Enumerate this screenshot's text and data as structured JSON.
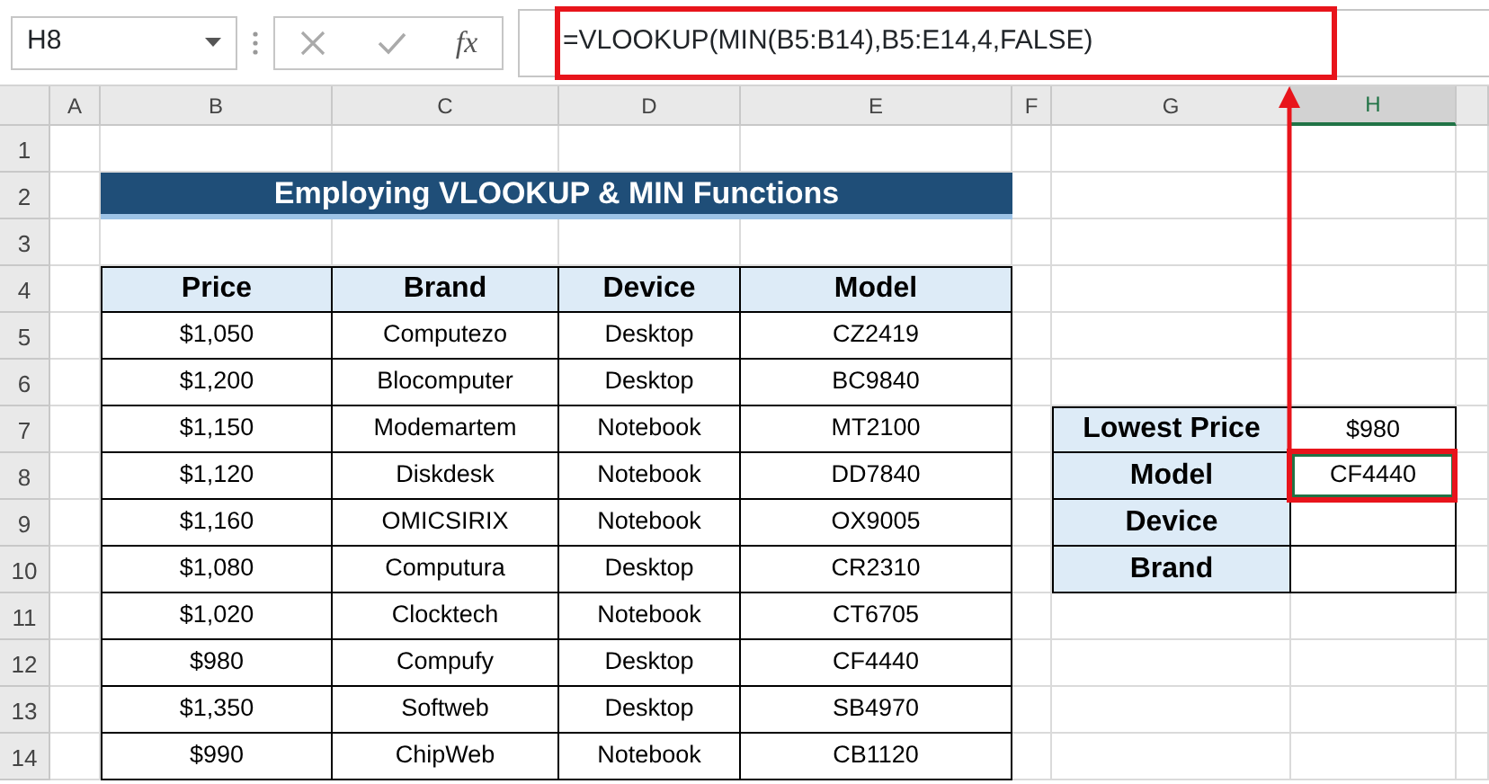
{
  "name_box": {
    "value": "H8"
  },
  "formula_bar": {
    "fx_label": "fx",
    "formula": "=VLOOKUP(MIN(B5:B14),B5:E14,4,FALSE)"
  },
  "columns": [
    {
      "label": "A",
      "selected": false
    },
    {
      "label": "B",
      "selected": false
    },
    {
      "label": "C",
      "selected": false
    },
    {
      "label": "D",
      "selected": false
    },
    {
      "label": "E",
      "selected": false
    },
    {
      "label": "F",
      "selected": false
    },
    {
      "label": "G",
      "selected": false
    },
    {
      "label": "H",
      "selected": true
    }
  ],
  "rows": [
    "1",
    "2",
    "3",
    "4",
    "5",
    "6",
    "7",
    "8",
    "9",
    "10",
    "11",
    "12",
    "13",
    "14"
  ],
  "title": "Employing VLOOKUP & MIN Functions",
  "table": {
    "columns": [
      "Price",
      "Brand",
      "Device",
      "Model"
    ],
    "rows": [
      [
        "$1,050",
        "Computezo",
        "Desktop",
        "CZ2419"
      ],
      [
        "$1,200",
        "Blocomputer",
        "Desktop",
        "BC9840"
      ],
      [
        "$1,150",
        "Modemartem",
        "Notebook",
        "MT2100"
      ],
      [
        "$1,120",
        "Diskdesk",
        "Notebook",
        "DD7840"
      ],
      [
        "$1,160",
        "OMICSIRIX",
        "Notebook",
        "OX9005"
      ],
      [
        "$1,080",
        "Computura",
        "Desktop",
        "CR2310"
      ],
      [
        "$1,020",
        "Clocktech",
        "Notebook",
        "CT6705"
      ],
      [
        "$980",
        "Compufy",
        "Desktop",
        "CF4440"
      ],
      [
        "$1,350",
        "Softweb",
        "Desktop",
        "SB4970"
      ],
      [
        "$990",
        "ChipWeb",
        "Notebook",
        "CB1120"
      ]
    ]
  },
  "lookup": [
    {
      "label": "Lowest Price",
      "value": "$980",
      "selected": false
    },
    {
      "label": "Model",
      "value": "CF4440",
      "selected": true
    },
    {
      "label": "Device",
      "selected": false
    },
    {
      "label": "Brand",
      "selected": false
    }
  ]
}
